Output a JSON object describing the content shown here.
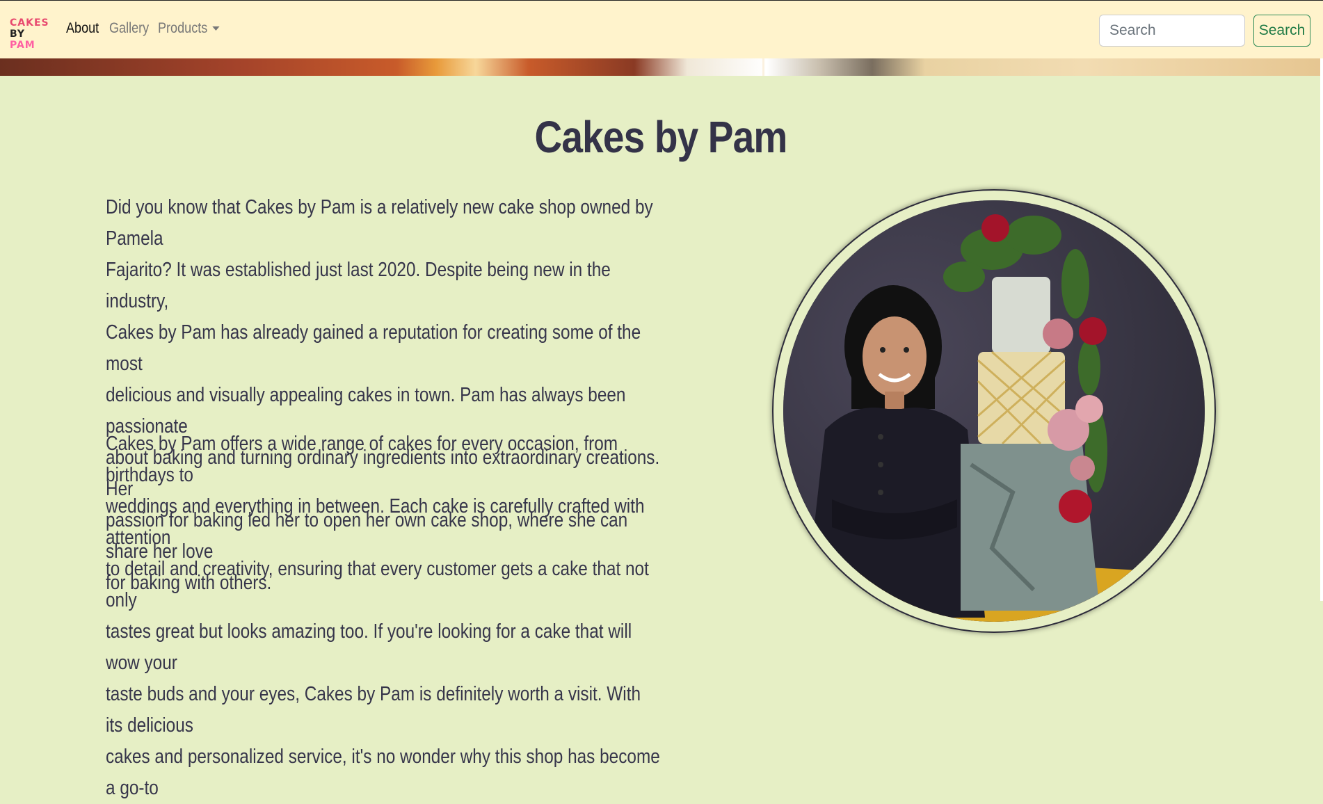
{
  "navbar": {
    "brand": {
      "line1": "CAKES",
      "line2_a": "BY",
      "line2_b": "PAM"
    },
    "links": {
      "about": "About",
      "gallery": "Gallery",
      "products": "Products"
    },
    "search": {
      "placeholder": "Search",
      "button_label": "Search"
    }
  },
  "main": {
    "title": "Cakes by Pam",
    "paragraphs": [
      "Did you know that Cakes by Pam is a relatively new cake shop owned by Pamela\nFajarito? It was established just last 2020. Despite being new in the industry,\nCakes by Pam has already gained a reputation for creating some of the most\ndelicious and visually appealing cakes in town. Pam has always been passionate\nabout baking and turning ordinary ingredients into extraordinary creations. Her\npassion for baking led her to open her own cake shop, where she can share her love\nfor baking with others.",
      "Cakes by Pam offers a wide range of cakes for every occasion, from birthdays to\nweddings and everything in between. Each cake is carefully crafted with attention\nto detail and creativity, ensuring that every customer gets a cake that not only\ntastes great but looks amazing too. If you're looking for a cake that will wow your\ntaste buds and your eyes, Cakes by Pam is definitely worth a visit. With its delicious\ncakes and personalized service, it's no wonder why this shop has become a go-to"
    ]
  },
  "colors": {
    "navbar_bg": "#fff3cc",
    "page_bg": "#e6efc5",
    "brand_pink": "#e84a6f",
    "search_green": "#1f7a45",
    "text": "#36354a"
  }
}
